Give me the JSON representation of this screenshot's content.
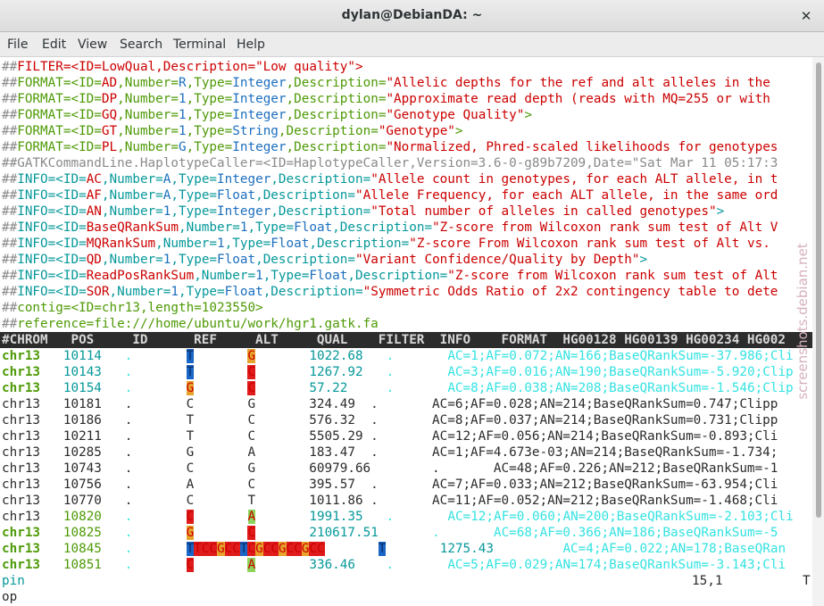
{
  "window": {
    "title": "dylan@DebianDA: ~"
  },
  "menu": [
    "File",
    "Edit",
    "View",
    "Search",
    "Terminal",
    "Help"
  ],
  "colors": {
    "meta": "#8a8a8a",
    "key_red": "#cc0000",
    "key_green": "#4e9a06",
    "key_cyan": "#06989a",
    "lt_green": "#73d216",
    "lt_cyan": "#34e2e2",
    "blue": "#1c6fbf",
    "dark": "#2b2b2b",
    "header_bg": "#2c2c2c",
    "header_fg": "#d8d8d8"
  },
  "terminal_lines": [
    {
      "segs": [
        [
          "##",
          "m"
        ],
        [
          "FILTER=<ID=LowQual,Description=",
          "r"
        ],
        [
          "\"Low quality\"",
          "r"
        ],
        [
          ">",
          "r"
        ]
      ]
    },
    {
      "segs": [
        [
          "##",
          "m"
        ],
        [
          "FORMAT=<ID=",
          "g"
        ],
        [
          "AD",
          "r"
        ],
        [
          ",Number=",
          "g"
        ],
        [
          "R",
          "b"
        ],
        [
          ",Type=",
          "g"
        ],
        [
          "Integer",
          "b"
        ],
        [
          ",Description=",
          "g"
        ],
        [
          "\"Allelic depths for the ref and alt alleles in the",
          "r"
        ]
      ]
    },
    {
      "segs": [
        [
          "##",
          "m"
        ],
        [
          "FORMAT=<ID=",
          "g"
        ],
        [
          "DP",
          "r"
        ],
        [
          ",Number=",
          "g"
        ],
        [
          "1",
          "b"
        ],
        [
          ",Type=",
          "g"
        ],
        [
          "Integer",
          "b"
        ],
        [
          ",Description=",
          "g"
        ],
        [
          "\"Approximate read depth (reads with MQ=255 or with",
          "r"
        ]
      ]
    },
    {
      "segs": [
        [
          "##",
          "m"
        ],
        [
          "FORMAT=<ID=",
          "g"
        ],
        [
          "GQ",
          "r"
        ],
        [
          ",Number=",
          "g"
        ],
        [
          "1",
          "b"
        ],
        [
          ",Type=",
          "g"
        ],
        [
          "Integer",
          "b"
        ],
        [
          ",Description=",
          "g"
        ],
        [
          "\"Genotype Quality\"",
          "r"
        ],
        [
          ">",
          "g"
        ]
      ]
    },
    {
      "segs": [
        [
          "##",
          "m"
        ],
        [
          "FORMAT=<ID=",
          "g"
        ],
        [
          "GT",
          "r"
        ],
        [
          ",Number=",
          "g"
        ],
        [
          "1",
          "b"
        ],
        [
          ",Type=",
          "g"
        ],
        [
          "String",
          "b"
        ],
        [
          ",Description=",
          "g"
        ],
        [
          "\"Genotype\"",
          "r"
        ],
        [
          ">",
          "g"
        ]
      ]
    },
    {
      "segs": [
        [
          "##",
          "m"
        ],
        [
          "FORMAT=<ID=",
          "g"
        ],
        [
          "PL",
          "r"
        ],
        [
          ",Number=",
          "g"
        ],
        [
          "G",
          "b"
        ],
        [
          ",Type=",
          "g"
        ],
        [
          "Integer",
          "b"
        ],
        [
          ",Description=",
          "g"
        ],
        [
          "\"Normalized, Phred-scaled likelihoods for genotypes",
          "r"
        ]
      ]
    },
    {
      "segs": [
        [
          "##GATKCommandLine.HaplotypeCaller=<ID=HaplotypeCaller,Version=3.6-0-g89b7209,Date=\"Sat Mar 11 05:17:3",
          "m"
        ]
      ]
    },
    {
      "segs": [
        [
          "##",
          "m"
        ],
        [
          "INFO=<ID=",
          "c"
        ],
        [
          "AC",
          "r"
        ],
        [
          ",Number=",
          "c"
        ],
        [
          "A",
          "b"
        ],
        [
          ",Type=",
          "c"
        ],
        [
          "Integer",
          "b"
        ],
        [
          ",Description=",
          "c"
        ],
        [
          "\"Allele count in genotypes, for each ALT allele, in t",
          "r"
        ]
      ]
    },
    {
      "segs": [
        [
          "##",
          "m"
        ],
        [
          "INFO=<ID=",
          "c"
        ],
        [
          "AF",
          "r"
        ],
        [
          ",Number=",
          "c"
        ],
        [
          "A",
          "b"
        ],
        [
          ",Type=",
          "c"
        ],
        [
          "Float",
          "b"
        ],
        [
          ",Description=",
          "c"
        ],
        [
          "\"Allele Frequency, for each ALT allele, in the same ord",
          "r"
        ]
      ]
    },
    {
      "segs": [
        [
          "##",
          "m"
        ],
        [
          "INFO=<ID=",
          "c"
        ],
        [
          "AN",
          "r"
        ],
        [
          ",Number=",
          "c"
        ],
        [
          "1",
          "b"
        ],
        [
          ",Type=",
          "c"
        ],
        [
          "Integer",
          "b"
        ],
        [
          ",Description=",
          "c"
        ],
        [
          "\"Total number of alleles in called genotypes\"",
          "r"
        ],
        [
          ">",
          "c"
        ]
      ]
    },
    {
      "segs": [
        [
          "##",
          "m"
        ],
        [
          "INFO=<ID=",
          "c"
        ],
        [
          "BaseQRankSum",
          "r"
        ],
        [
          ",Number=",
          "c"
        ],
        [
          "1",
          "b"
        ],
        [
          ",Type=",
          "c"
        ],
        [
          "Float",
          "b"
        ],
        [
          ",Description=",
          "c"
        ],
        [
          "\"Z-score from Wilcoxon rank sum test of Alt V",
          "r"
        ]
      ]
    },
    {
      "segs": [
        [
          "##",
          "m"
        ],
        [
          "INFO=<ID=",
          "c"
        ],
        [
          "MQRankSum",
          "r"
        ],
        [
          ",Number=",
          "c"
        ],
        [
          "1",
          "b"
        ],
        [
          ",Type=",
          "c"
        ],
        [
          "Float",
          "b"
        ],
        [
          ",Description=",
          "c"
        ],
        [
          "\"Z-score From Wilcoxon rank sum test of Alt vs. ",
          "r"
        ]
      ]
    },
    {
      "segs": [
        [
          "##",
          "m"
        ],
        [
          "INFO=<ID=",
          "c"
        ],
        [
          "QD",
          "r"
        ],
        [
          ",Number=",
          "c"
        ],
        [
          "1",
          "b"
        ],
        [
          ",Type=",
          "c"
        ],
        [
          "Float",
          "b"
        ],
        [
          ",Description=",
          "c"
        ],
        [
          "\"Variant Confidence/Quality by Depth\"",
          "r"
        ],
        [
          ">",
          "c"
        ]
      ]
    },
    {
      "segs": [
        [
          "##",
          "m"
        ],
        [
          "INFO=<ID=",
          "c"
        ],
        [
          "ReadPosRankSum",
          "r"
        ],
        [
          ",Number=",
          "c"
        ],
        [
          "1",
          "b"
        ],
        [
          ",Type=",
          "c"
        ],
        [
          "Float",
          "b"
        ],
        [
          ",Description=",
          "c"
        ],
        [
          "\"Z-score from Wilcoxon rank sum test of Alt",
          "r"
        ]
      ]
    },
    {
      "segs": [
        [
          "##",
          "m"
        ],
        [
          "INFO=<ID=",
          "c"
        ],
        [
          "SOR",
          "r"
        ],
        [
          ",Number=",
          "c"
        ],
        [
          "1",
          "b"
        ],
        [
          ",Type=",
          "c"
        ],
        [
          "Float",
          "b"
        ],
        [
          ",Description=",
          "c"
        ],
        [
          "\"Symmetric Odds Ratio of 2x2 contingency table to dete",
          "r"
        ]
      ]
    },
    {
      "segs": [
        [
          "##",
          "m"
        ],
        [
          "contig=<ID=chr13,length=1023550>",
          "g"
        ]
      ]
    },
    {
      "segs": [
        [
          "##",
          "m"
        ],
        [
          "reference=file:///home/ubuntu/work/hgr1.gatk.fa",
          "g"
        ]
      ]
    },
    {
      "segs": [
        [
          "#CHROM   POS     ID      REF     ALT     QUAL    FILTER  INFO    FORMAT  HG00128 HG00139 HG00234 HG002",
          "h"
        ]
      ]
    },
    {
      "segs": [
        [
          "chr13",
          "gb"
        ],
        [
          "   10114   ",
          "c"
        ],
        [
          ".",
          "lc"
        ],
        [
          "       ",
          "d"
        ],
        [
          "T",
          "hb"
        ],
        [
          "       ",
          "d"
        ],
        [
          "G",
          "ho"
        ],
        [
          "       ",
          "d"
        ],
        [
          "1022.68",
          "c"
        ],
        [
          "   ",
          "d"
        ],
        [
          ".",
          "lc"
        ],
        [
          "       ",
          "d"
        ],
        [
          "AC=1;AF=0.072;AN=166;BaseQRankSum=-37.986;Cli",
          "lc"
        ]
      ]
    },
    {
      "segs": [
        [
          "chr13",
          "gb"
        ],
        [
          "   10143   ",
          "c"
        ],
        [
          ".",
          "lc"
        ],
        [
          "       ",
          "d"
        ],
        [
          "T",
          "hb"
        ],
        [
          "       ",
          "d"
        ],
        [
          "C",
          "hr"
        ],
        [
          "       ",
          "d"
        ],
        [
          "1267.92",
          "c"
        ],
        [
          "   ",
          "d"
        ],
        [
          ".",
          "lc"
        ],
        [
          "       ",
          "d"
        ],
        [
          "AC=3;AF=0.016;AN=190;BaseQRankSum=-5.920;Clip",
          "lc"
        ]
      ]
    },
    {
      "segs": [
        [
          "chr13",
          "gb"
        ],
        [
          "   10154   ",
          "c"
        ],
        [
          ".",
          "lc"
        ],
        [
          "       ",
          "d"
        ],
        [
          "G",
          "ho"
        ],
        [
          "       ",
          "d"
        ],
        [
          "C",
          "hr"
        ],
        [
          "       ",
          "d"
        ],
        [
          "57.22",
          "c"
        ],
        [
          "     ",
          "d"
        ],
        [
          ".",
          "lc"
        ],
        [
          "       ",
          "d"
        ],
        [
          "AC=8;AF=0.038;AN=208;BaseQRankSum=-1.546;Clip",
          "lc"
        ]
      ]
    },
    {
      "segs": [
        [
          "chr13   10181   .       C       G       324.49  .       AC=6;AF=0.028;AN=214;BaseQRankSum=0.747;Clipp",
          "d"
        ]
      ]
    },
    {
      "segs": [
        [
          "chr13   10186   .       T       C       576.32  .       AC=8;AF=0.037;AN=214;BaseQRankSum=0.731;Clipp",
          "d"
        ]
      ]
    },
    {
      "segs": [
        [
          "chr13   10211   .       T       C       5505.29 .       AC=12;AF=0.056;AN=214;BaseQRankSum=-0.893;Cli",
          "d"
        ]
      ]
    },
    {
      "segs": [
        [
          "chr13   10285   .       G       A       183.47  .       AC=1;AF=4.673e-03;AN=214;BaseQRankSum=-1.734;",
          "d"
        ]
      ]
    },
    {
      "segs": [
        [
          "chr13   10743   .       C       G       60979.66        .       AC=48;AF=0.226;AN=212;BaseQRankSum=-1",
          "d"
        ]
      ]
    },
    {
      "segs": [
        [
          "chr13   10756   .       A       C       395.57  .       AC=7;AF=0.033;AN=212;BaseQRankSum=-63.954;Cli",
          "d"
        ]
      ]
    },
    {
      "segs": [
        [
          "chr13   10770   .       C       T       1011.86 .       AC=11;AF=0.052;AN=212;BaseQRankSum=-1.468;Cli",
          "d"
        ]
      ]
    },
    {
      "segs": [
        [
          "chr13   ",
          "d"
        ],
        [
          "10820",
          "g"
        ],
        [
          "   ",
          "d"
        ],
        [
          ".",
          "lc"
        ],
        [
          "       ",
          "d"
        ],
        [
          "C",
          "hr"
        ],
        [
          "       ",
          "d"
        ],
        [
          "A",
          "hg"
        ],
        [
          "       ",
          "d"
        ],
        [
          "1991.35",
          "c"
        ],
        [
          "   ",
          "d"
        ],
        [
          ".",
          "lc"
        ],
        [
          "       ",
          "d"
        ],
        [
          "AC=12;AF=0.060;AN=200;BaseQRankSum=-2.103;Cli",
          "lc"
        ]
      ]
    },
    {
      "segs": [
        [
          "chr13",
          "gb"
        ],
        [
          "   10825   ",
          "g"
        ],
        [
          ".",
          "lc"
        ],
        [
          "       ",
          "d"
        ],
        [
          "G",
          "ho"
        ],
        [
          "       ",
          "d"
        ],
        [
          "C",
          "hr"
        ],
        [
          "       ",
          "d"
        ],
        [
          "210617.51",
          "c"
        ],
        [
          "       ",
          "d"
        ],
        [
          ".",
          "lc"
        ],
        [
          "       ",
          "d"
        ],
        [
          "AC=68;AF=0.366;AN=186;BaseQRankSum=-5",
          "lc"
        ]
      ]
    },
    {
      "segs": [
        [
          "chr13",
          "gb"
        ],
        [
          "   10845   ",
          "g"
        ],
        [
          ".",
          "lc"
        ],
        [
          "       ",
          "d"
        ],
        [
          "T",
          "hb"
        ],
        [
          "T",
          "hr"
        ],
        [
          "C",
          "hr"
        ],
        [
          "C",
          "hr"
        ],
        [
          "G",
          "ho"
        ],
        [
          "C",
          "hr"
        ],
        [
          "C",
          "hr"
        ],
        [
          "T",
          "hb"
        ],
        [
          "C",
          "hr"
        ],
        [
          "G",
          "ho"
        ],
        [
          "C",
          "hr"
        ],
        [
          "C",
          "hr"
        ],
        [
          "G",
          "ho"
        ],
        [
          "C",
          "hr"
        ],
        [
          "C",
          "hr"
        ],
        [
          "G",
          "ho"
        ],
        [
          "C",
          "hr"
        ],
        [
          "C",
          "hr"
        ],
        [
          "       ",
          "d"
        ],
        [
          "T",
          "hb"
        ],
        [
          "       ",
          "d"
        ],
        [
          "1275.43",
          "c"
        ],
        [
          "         ",
          "d"
        ],
        [
          "AC=4;AF=0.022;AN=178;BaseQRan",
          "lc"
        ]
      ]
    },
    {
      "segs": [
        [
          "chr13",
          "gb"
        ],
        [
          "   10851   ",
          "g"
        ],
        [
          ".",
          "lc"
        ],
        [
          "       ",
          "d"
        ],
        [
          "C",
          "hr"
        ],
        [
          "       ",
          "d"
        ],
        [
          "A",
          "hg"
        ],
        [
          "       ",
          "d"
        ],
        [
          "336.46",
          "c"
        ],
        [
          "    ",
          "d"
        ],
        [
          ".",
          "lc"
        ],
        [
          "       ",
          "d"
        ],
        [
          "AC=5;AF=0.029;AN=174;BaseQRankSum=-3.143;Cli",
          "lc"
        ]
      ]
    },
    {
      "segs": [
        [
          "pin",
          "c"
        ]
      ]
    },
    {
      "segs": [
        [
          "op",
          "d"
        ]
      ]
    }
  ],
  "status": {
    "position": "15,1",
    "scroll": "T"
  },
  "watermark": "screenshots.debian.net"
}
